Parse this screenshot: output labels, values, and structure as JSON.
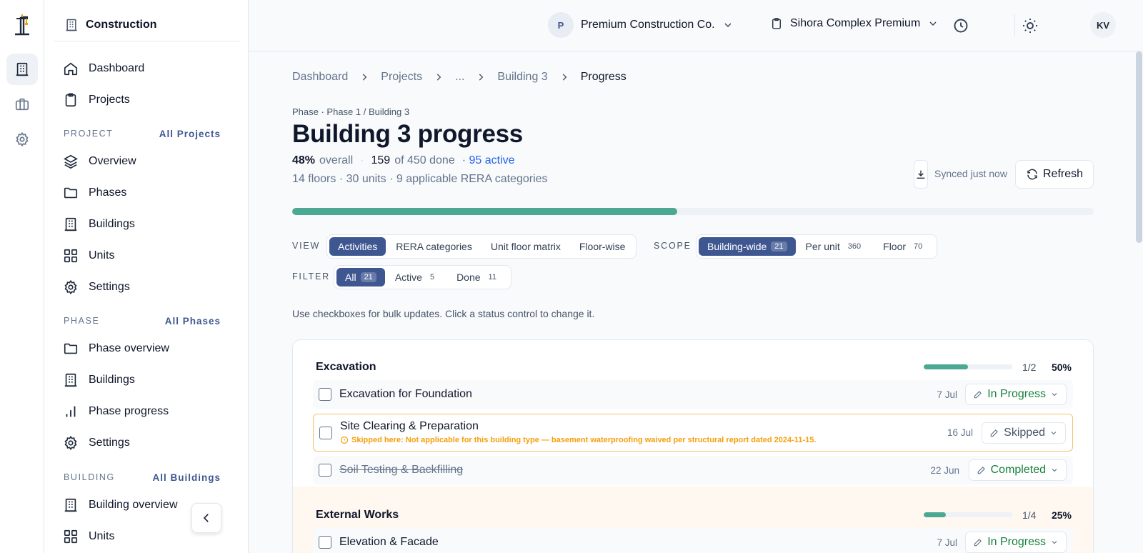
{
  "sidebar": {
    "title": "Construction",
    "nav": [
      {
        "label": "Dashboard",
        "icon": "home-icon"
      },
      {
        "label": "Projects",
        "icon": "clipboard-icon"
      }
    ],
    "project_section": {
      "label": "PROJECT",
      "link": "All Projects"
    },
    "project_items": [
      {
        "label": "Overview",
        "icon": "layers-icon"
      },
      {
        "label": "Phases",
        "icon": "folder-icon"
      },
      {
        "label": "Buildings",
        "icon": "building-icon"
      },
      {
        "label": "Units",
        "icon": "grid-icon"
      },
      {
        "label": "Settings",
        "icon": "gear-icon"
      }
    ],
    "phase_section": {
      "label": "PHASE",
      "link": "All Phases"
    },
    "phase_items": [
      {
        "label": "Phase overview",
        "icon": "folder-icon"
      },
      {
        "label": "Buildings",
        "icon": "building-icon"
      },
      {
        "label": "Phase progress",
        "icon": "bar-chart-icon"
      },
      {
        "label": "Settings",
        "icon": "gear-icon"
      }
    ],
    "building_section": {
      "label": "BUILDING",
      "link": "All Buildings"
    },
    "building_items": [
      {
        "label": "Building overview",
        "icon": "building-icon"
      },
      {
        "label": "Units",
        "icon": "grid-icon"
      }
    ]
  },
  "topbar": {
    "org_initial": "P",
    "org_name": "Premium Construction Co.",
    "project_name": "Sihora Complex Premium",
    "user_initials": "KV"
  },
  "breadcrumb": [
    "Dashboard",
    "Projects",
    "...",
    "Building 3",
    "Progress"
  ],
  "header": {
    "phase_line": "Phase · Phase 1 / Building 3",
    "title": "Building 3 progress",
    "percent": "48%",
    "overall_label": "overall",
    "dot": "·",
    "done_count": "159",
    "done_rest": "of 450 done",
    "active": "· 95 active",
    "meta": "14 floors · 30 units · 9 applicable RERA categories",
    "synced": "Synced just now",
    "refresh": "Refresh",
    "progress": 0.48
  },
  "view": {
    "label": "VIEW",
    "options": [
      "Activities",
      "RERA categories",
      "Unit floor matrix",
      "Floor-wise"
    ]
  },
  "scope": {
    "label": "SCOPE",
    "options": [
      {
        "label": "Building-wide",
        "count": "21"
      },
      {
        "label": "Per unit",
        "count": "360"
      },
      {
        "label": "Floor",
        "count": "70"
      }
    ]
  },
  "filter": {
    "label": "FILTER",
    "options": [
      {
        "label": "All",
        "count": "21"
      },
      {
        "label": "Active",
        "count": "5"
      },
      {
        "label": "Done",
        "count": "11"
      }
    ]
  },
  "hint": "Use checkboxes for bulk updates. Click a status control to change it.",
  "groups": [
    {
      "title": "Excavation",
      "fraction": "1/2",
      "percent": "50%",
      "progress": 0.5,
      "rows": [
        {
          "name": "Excavation for Foundation",
          "date": "7 Jul",
          "status": "In Progress"
        },
        {
          "name": "Site Clearing & Preparation",
          "date": "16 Jul",
          "status": "Skipped",
          "note": "Skipped here: Not applicable for this building type — basement waterproofing waived per structural report dated 2024-11-15."
        },
        {
          "name": "Soil Testing & Backfilling",
          "date": "22 Jun",
          "status": "Completed"
        }
      ]
    },
    {
      "title": "External Works",
      "fraction": "1/4",
      "percent": "25%",
      "progress": 0.25,
      "rows": [
        {
          "name": "Elevation & Facade",
          "date": "7 Jul",
          "status": "In Progress"
        }
      ]
    }
  ]
}
